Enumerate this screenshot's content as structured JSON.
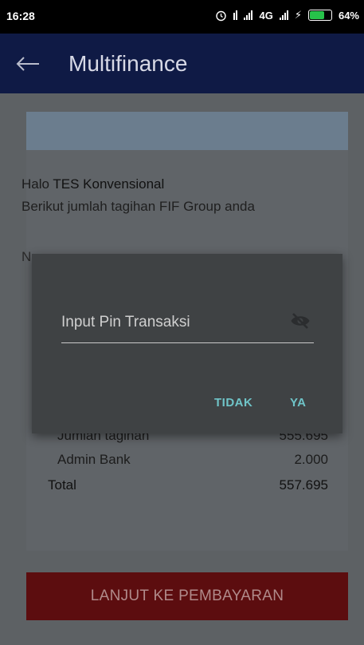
{
  "status_bar": {
    "time": "16:28",
    "network": "4G",
    "battery": "64%"
  },
  "app_bar": {
    "title": "Multifinance"
  },
  "card": {
    "greeting_prefix": "Halo",
    "customer_name": "TES Konvensional",
    "subtitle": "Berikut jumlah tagihan FIF Group anda",
    "partial_label": "N",
    "rows": [
      {
        "label": "Jumlah tagihan",
        "value": "555.695"
      },
      {
        "label": "Admin Bank",
        "value": "2.000"
      }
    ],
    "total": {
      "label": "Total",
      "value": "557.695"
    }
  },
  "primary_button": "LANJUT KE PEMBAYARAN",
  "dialog": {
    "pin_placeholder": "Input Pin Transaksi",
    "pin_value": "",
    "cancel": "TIDAK",
    "confirm": "YA"
  },
  "colors": {
    "app_bar": "#0f1a45",
    "button_red": "#5c0d0f",
    "dialog_accent": "#6fc4c8"
  }
}
